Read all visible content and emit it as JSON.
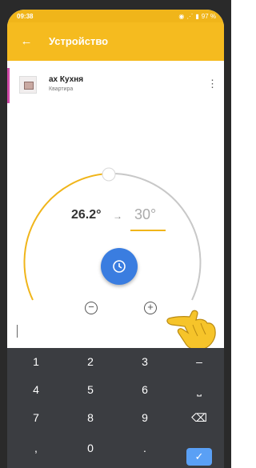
{
  "status_bar": {
    "time": "09:38",
    "battery_text": "97 %"
  },
  "app_bar": {
    "title": "Устройство"
  },
  "device": {
    "name": "ах Кухня",
    "subtitle": "Квартира"
  },
  "thermostat": {
    "current_temp": "26.2°",
    "arrow": "→",
    "target_temp": "30°"
  },
  "keypad": {
    "rows": [
      [
        "1",
        "2",
        "3",
        "–"
      ],
      [
        "4",
        "5",
        "6",
        "⎵"
      ],
      [
        "7",
        "8",
        "9",
        "⌫"
      ],
      [
        ",",
        "0",
        ".",
        "✓"
      ]
    ]
  },
  "colors": {
    "accent_yellow": "#f5bb1f",
    "accent_blue": "#3a7de0",
    "pink_marker": "#d04aa8",
    "keypad_bg": "#3b3d41"
  },
  "icons": [
    "back-arrow-icon",
    "kebab-menu-icon",
    "clock-icon",
    "minus-icon",
    "plus-icon",
    "pointing-hand-icon",
    "backspace-icon",
    "check-icon"
  ]
}
